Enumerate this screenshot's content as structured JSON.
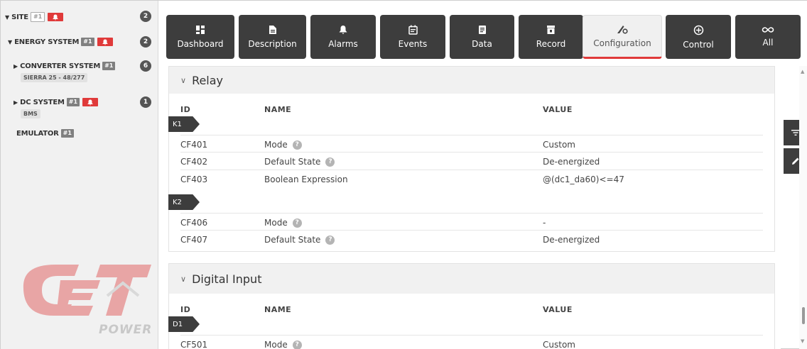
{
  "sidebar": {
    "site": {
      "label": "SITE",
      "id_tag": "#1",
      "count": "2"
    },
    "energy_system": {
      "label": "ENERGY SYSTEM",
      "id_tag": "#1",
      "count": "2"
    },
    "converter_system": {
      "label": "CONVERTER SYSTEM",
      "id_tag": "#1",
      "count": "6",
      "sub": "SIERRA 25 - 48/277"
    },
    "dc_system": {
      "label": "DC SYSTEM",
      "id_tag": "#1",
      "count": "1",
      "sub": "BMS"
    },
    "emulator": {
      "label": "EMULATOR",
      "id_tag": "#1"
    },
    "logo_text": "POWER"
  },
  "toolbar": {
    "buttons": [
      {
        "label": "Dashboard",
        "icon": "dashboard-icon"
      },
      {
        "label": "Description",
        "icon": "document-icon"
      },
      {
        "label": "Alarms",
        "icon": "alarm-icon"
      },
      {
        "label": "Events",
        "icon": "calendar-icon"
      },
      {
        "label": "Data",
        "icon": "data-icon"
      },
      {
        "label": "Record",
        "icon": "record-icon"
      },
      {
        "label": "Configuration",
        "icon": "configuration-icon",
        "active": true
      },
      {
        "label": "Control",
        "icon": "control-icon"
      },
      {
        "label": "All",
        "icon": "infinity-icon"
      }
    ]
  },
  "relay": {
    "title": "Relay",
    "col_id": "ID",
    "col_name": "NAME",
    "col_value": "VALUE",
    "group_k1": "K1",
    "group_k2": "K2",
    "rows_k1": [
      {
        "id": "CF401",
        "name": "Mode",
        "help": true,
        "value": "Custom"
      },
      {
        "id": "CF402",
        "name": "Default State",
        "help": true,
        "value": "De-energized"
      },
      {
        "id": "CF403",
        "name": "Boolean Expression",
        "help": false,
        "value": "@(dc1_da60)<=47"
      }
    ],
    "rows_k2": [
      {
        "id": "CF406",
        "name": "Mode",
        "help": true,
        "value": "-"
      },
      {
        "id": "CF407",
        "name": "Default State",
        "help": true,
        "value": "De-energized"
      }
    ]
  },
  "digital_input": {
    "title": "Digital Input",
    "col_id": "ID",
    "col_name": "NAME",
    "col_value": "VALUE",
    "group_d1": "D1",
    "rows_d1": [
      {
        "id": "CF501",
        "name": "Mode",
        "help": true,
        "value": "Custom"
      }
    ]
  },
  "colors": {
    "dark": "#3d3d3d",
    "accent": "#e03a3a",
    "header_bg": "#f1f1f1"
  }
}
